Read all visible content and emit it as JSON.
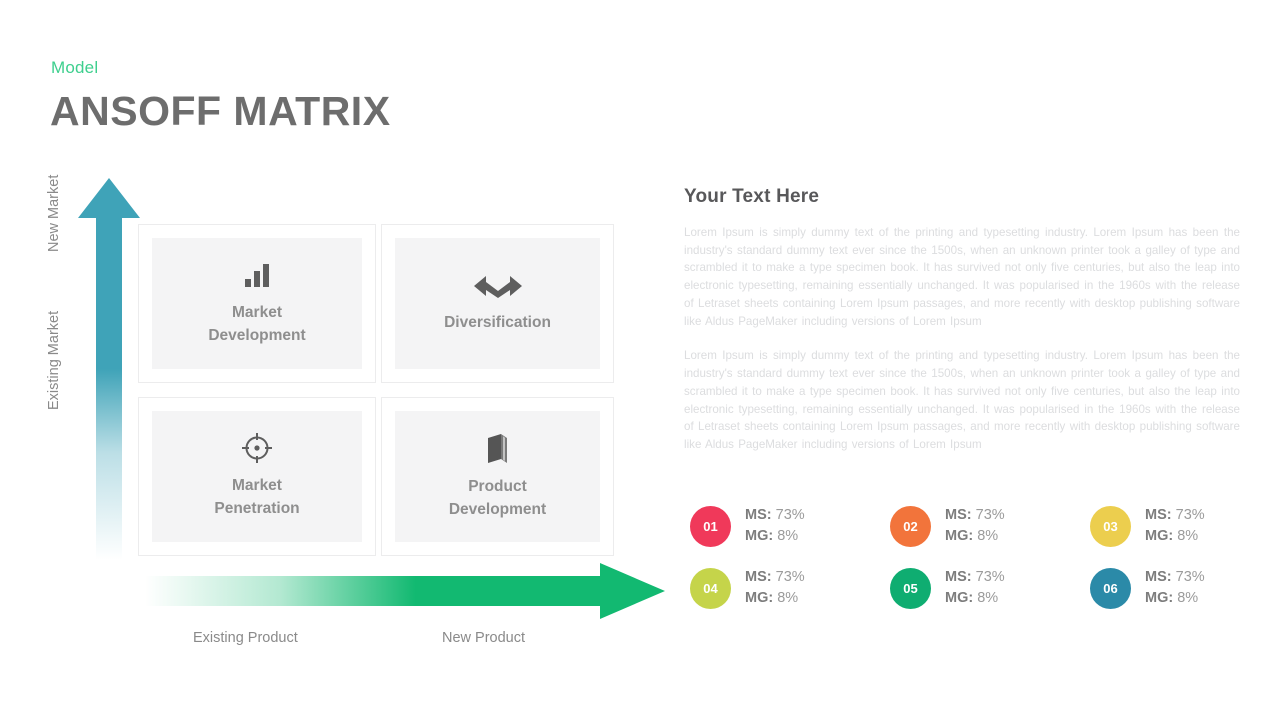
{
  "header": {
    "subtitle": "Model",
    "title": "ANSOFF MATRIX",
    "subtitle_color": "#3ecf8e",
    "title_color": "#6d6d6d"
  },
  "matrix": {
    "vertical_axis": {
      "arrow_color": "#3fa3b8",
      "labels": {
        "top": "New Market",
        "bottom": "Existing Market"
      }
    },
    "horizontal_axis": {
      "arrow_color": "#12b971",
      "labels": {
        "left": "Existing Product",
        "right": "New Product"
      }
    },
    "quadrants": [
      {
        "id": "market-development",
        "label": "Market\nDevelopment",
        "label_line1": "Market",
        "label_line2": "Development",
        "icon": "bar-chart-icon"
      },
      {
        "id": "diversification",
        "label": "Diversification",
        "label_line1": "Diversification",
        "label_line2": "",
        "icon": "double-arrow-icon"
      },
      {
        "id": "market-penetration",
        "label": "Market\nPenetration",
        "label_line1": "Market",
        "label_line2": "Penetration",
        "icon": "target-icon"
      },
      {
        "id": "product-development",
        "label": "Product\nDevelopment",
        "label_line1": "Product",
        "label_line2": "Development",
        "icon": "book-icon"
      }
    ]
  },
  "right_panel": {
    "title": "Your  Text Here",
    "paragraphs": [
      "Lorem Ipsum is simply dummy text of the printing and typesetting industry. Lorem Ipsum has been the industry's standard dummy text ever since the 1500s, when an unknown printer took a galley of type and scrambled it to make a type specimen book. It has survived  not only five centuries, but also the leap into electronic typesetting, remaining essentially unchanged.  It was popularised in the 1960s with the release of Letraset sheets containing Lorem Ipsum passages, and more recently with desktop publishing software  like Aldus PageMaker including versions of Lorem Ipsum",
      "Lorem Ipsum is simply dummy text of the printing and typesetting industry. Lorem Ipsum has been the industry's standard dummy text ever since the 1500s, when an unknown printer took a galley of type and scrambled it to make a type specimen book. It has survived  not only five centuries, but also the leap into electronic typesetting, remaining essentially unchanged.  It was popularised in the 1960s with the release of Letraset sheets containing Lorem Ipsum passages, and more recently with desktop publishing software  like Aldus PageMaker including versions of Lorem Ipsum"
    ]
  },
  "stats": [
    {
      "number": "01",
      "color": "#f0395a",
      "ms_label": "MS:",
      "ms_value": "73%",
      "mg_label": "MG:",
      "mg_value": "8%"
    },
    {
      "number": "02",
      "color": "#f2743b",
      "ms_label": "MS:",
      "ms_value": "73%",
      "mg_label": "MG:",
      "mg_value": "8%"
    },
    {
      "number": "03",
      "color": "#ecce4e",
      "ms_label": "MS:",
      "ms_value": "73%",
      "mg_label": "MG:",
      "mg_value": "8%"
    },
    {
      "number": "04",
      "color": "#c5d44a",
      "ms_label": "MS:",
      "ms_value": "73%",
      "mg_label": "MG:",
      "mg_value": "8%"
    },
    {
      "number": "05",
      "color": "#0fad71",
      "ms_label": "MS:",
      "ms_value": "73%",
      "mg_label": "MG:",
      "mg_value": "8%"
    },
    {
      "number": "06",
      "color": "#2b8aa8",
      "ms_label": "MS:",
      "ms_value": "73%",
      "mg_label": "MG:",
      "mg_value": "8%"
    }
  ]
}
